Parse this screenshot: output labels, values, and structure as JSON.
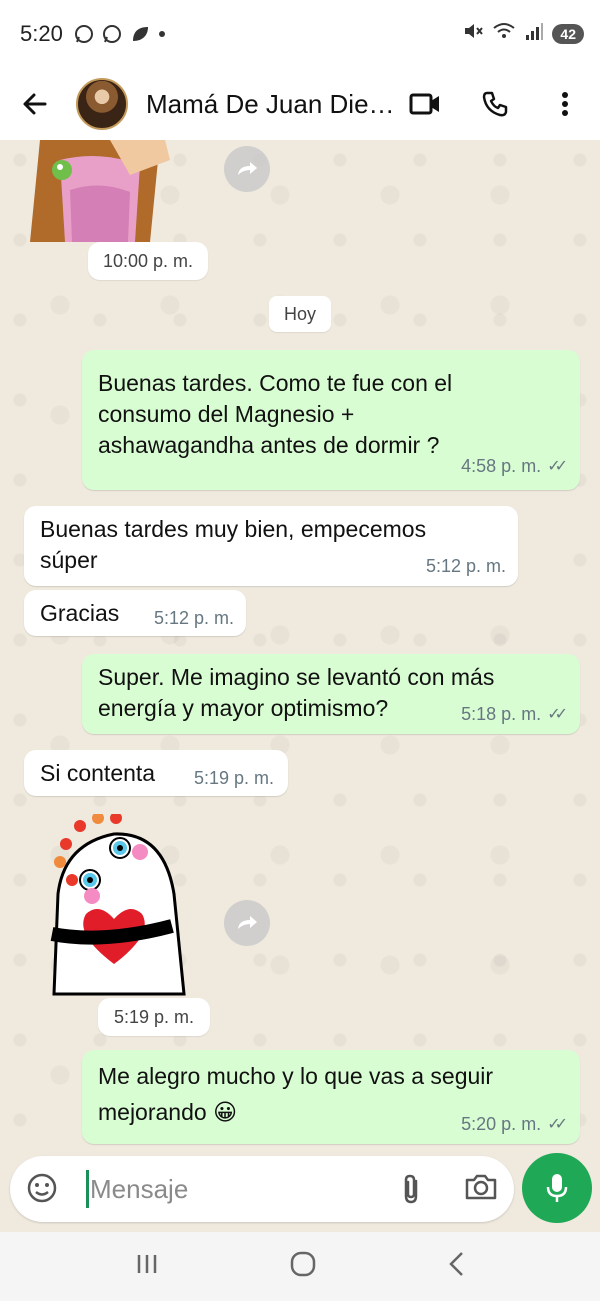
{
  "status_bar": {
    "time": "5:20",
    "battery": "42"
  },
  "header": {
    "contact_name": "Mamá De Juan Die…"
  },
  "chat": {
    "top_sticker_time": "10:00 p. m.",
    "day_label": "Hoy",
    "messages": [
      {
        "direction": "out",
        "text": "Buenas tardes.  Como te fue con el consumo del Magnesio + ashawagandha antes de dormir ?",
        "time": "4:58 p. m."
      },
      {
        "direction": "in",
        "text": "Buenas tardes muy bien, empecemos súper",
        "time": "5:12 p. m."
      },
      {
        "direction": "in",
        "text": "Gracias",
        "time": "5:12 p. m."
      },
      {
        "direction": "out",
        "text": "Super. Me imagino se levantó con más energía y mayor optimismo?",
        "time": "5:18 p. m."
      },
      {
        "direction": "in",
        "text": "Si contenta",
        "time": "5:19 p. m."
      },
      {
        "direction": "out",
        "text": "Me alegro mucho y lo que vas a seguir mejorando 😀",
        "time": "5:20 p. m."
      }
    ],
    "sticker_time": "5:19 p. m."
  },
  "input": {
    "placeholder": "Mensaje"
  },
  "colors": {
    "outgoing_bubble": "#d9fdd3",
    "incoming_bubble": "#ffffff",
    "chat_background": "#efe9de",
    "accent_green": "#1fa855"
  }
}
